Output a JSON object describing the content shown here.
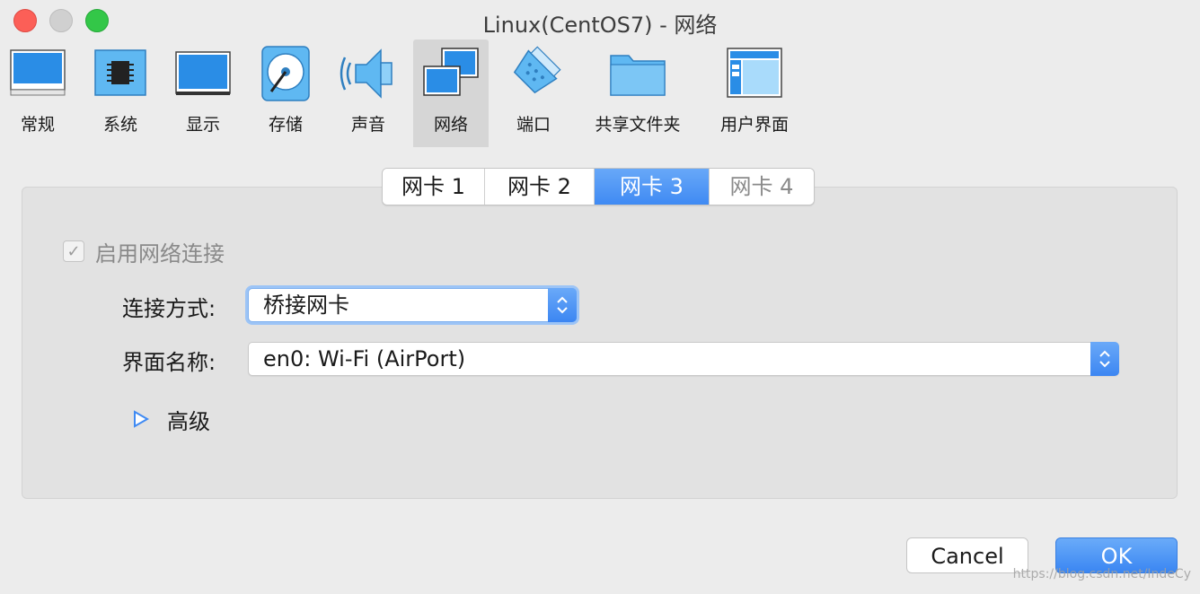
{
  "window": {
    "title": "Linux(CentOS7) - 网络"
  },
  "toolbar": {
    "items": [
      {
        "label": "常规",
        "icon": "monitor-general-icon"
      },
      {
        "label": "系统",
        "icon": "chip-icon"
      },
      {
        "label": "显示",
        "icon": "display-icon"
      },
      {
        "label": "存储",
        "icon": "storage-disk-icon"
      },
      {
        "label": "声音",
        "icon": "speaker-icon"
      },
      {
        "label": "网络",
        "icon": "network-icon",
        "selected": true
      },
      {
        "label": "端口",
        "icon": "serial-port-icon"
      },
      {
        "label": "共享文件夹",
        "icon": "folder-icon"
      },
      {
        "label": "用户界面",
        "icon": "user-interface-icon"
      }
    ]
  },
  "tabs": [
    {
      "label": "网卡 1"
    },
    {
      "label": "网卡 2"
    },
    {
      "label": "网卡 3",
      "active": true
    },
    {
      "label": "网卡 4"
    }
  ],
  "adapter": {
    "enable_label": "启用网络连接",
    "enabled": true,
    "attached_label": "连接方式:",
    "attached_value": "桥接网卡",
    "name_label": "界面名称:",
    "name_value": "en0: Wi-Fi (AirPort)",
    "advanced_label": "高级"
  },
  "buttons": {
    "cancel": "Cancel",
    "ok": "OK"
  },
  "watermark": "https://blog.csdn.net/IndeCy",
  "colors": {
    "accent": "#3f8af3",
    "close": "#fc5f57",
    "maximize": "#33c748"
  }
}
